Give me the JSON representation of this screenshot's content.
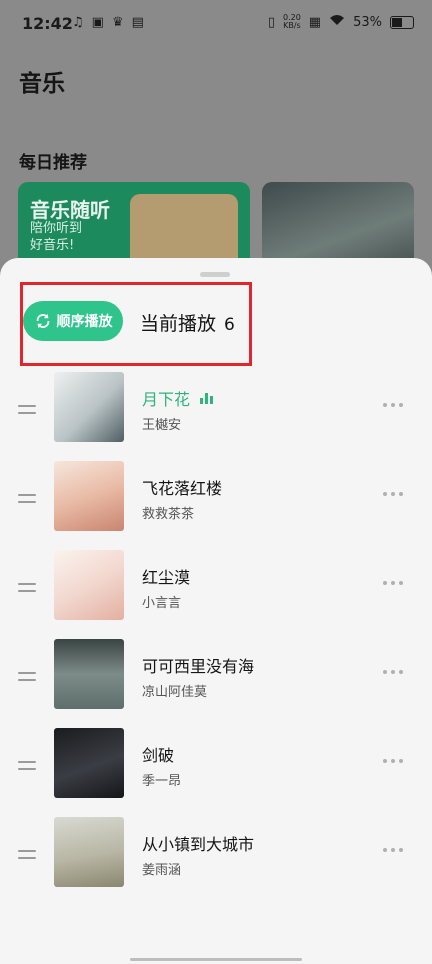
{
  "status_bar": {
    "time": "12:42",
    "speed_value": "0.20",
    "speed_unit": "KB/s",
    "battery": "53%"
  },
  "app": {
    "title": "音乐",
    "section_title": "每日推荐"
  },
  "daily_card": {
    "title": "音乐随听",
    "subtitle_line1": "陪你听到",
    "subtitle_line2": "好音乐!"
  },
  "sheet": {
    "mode_label": "顺序播放",
    "title": "当前播放",
    "count": "6"
  },
  "queue": [
    {
      "song": "月下花",
      "artist": "王樾安",
      "playing": true
    },
    {
      "song": "飞花落红楼",
      "artist": "救救茶茶",
      "playing": false
    },
    {
      "song": "红尘漠",
      "artist": "小言言",
      "playing": false
    },
    {
      "song": "可可西里没有海",
      "artist": "凉山阿佳莫",
      "playing": false
    },
    {
      "song": "剑破",
      "artist": "季一昂",
      "playing": false
    },
    {
      "song": "从小镇到大城市",
      "artist": "姜雨涵",
      "playing": false
    }
  ],
  "colors": {
    "accent": "#2fc48c",
    "highlight_border": "#e0272d",
    "playing_text": "#2fb47e"
  }
}
